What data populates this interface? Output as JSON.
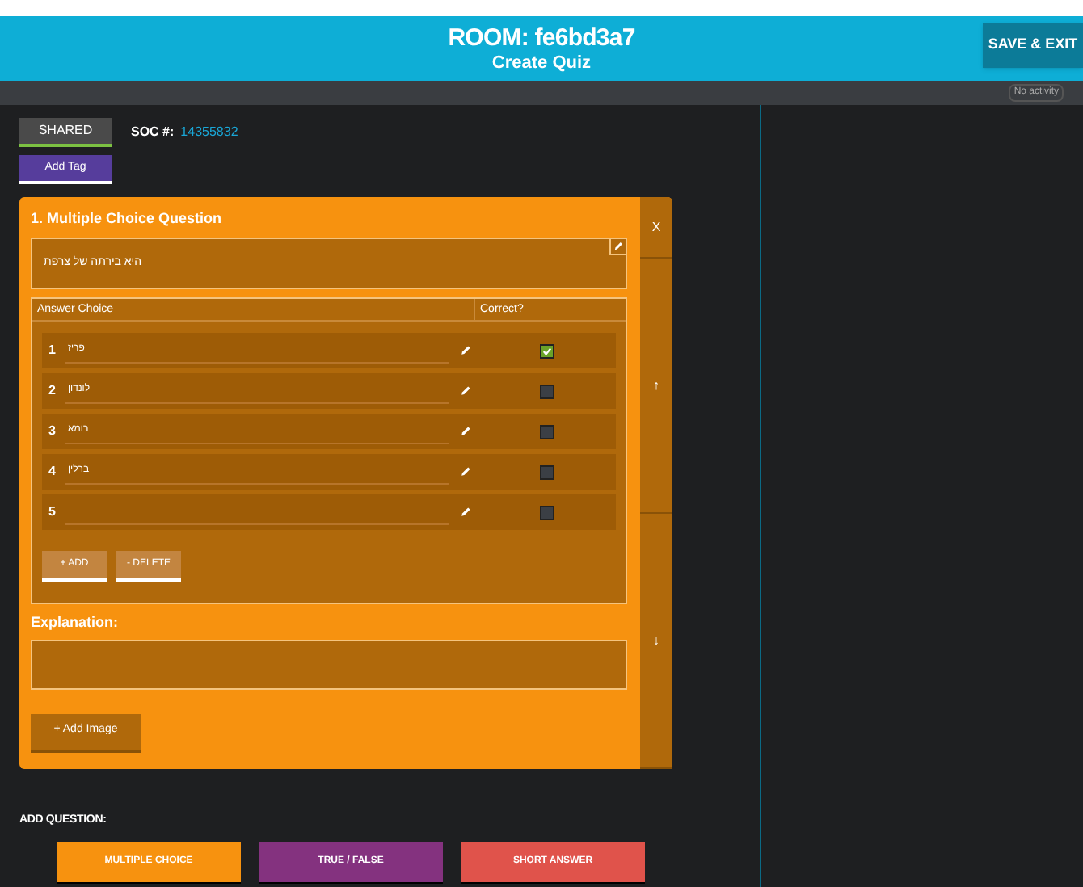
{
  "header": {
    "title": "ROOM: fe6bd3a7",
    "subtitle": "Create Quiz",
    "save_button": "SAVE & EXIT"
  },
  "status_bar": {
    "activity": "No activity"
  },
  "shared_button": "SHARED",
  "soc": {
    "label": "SOC #:",
    "value": "14355832"
  },
  "add_tag_button": "Add Tag",
  "question": {
    "title": "1. Multiple Choice Question",
    "text": "היא בירתה של צרפת",
    "side_buttons": [
      "X",
      "↑",
      "↓"
    ],
    "columns": [
      "Answer Choice",
      "Correct?"
    ],
    "answers": [
      {
        "number": "1",
        "text": "פריז",
        "checked": true
      },
      {
        "number": "2",
        "text": "לונדון",
        "checked": false
      },
      {
        "number": "3",
        "text": "רומא",
        "checked": false
      },
      {
        "number": "4",
        "text": "ברלין",
        "checked": false
      },
      {
        "number": "5",
        "checked": false
      }
    ],
    "add_button": "+ ADD",
    "delete_button": "- DELETE",
    "explanation_label": "Explanation:",
    "add_image_button": "+ Add Image"
  },
  "add_question": {
    "label": "ADD QUESTION:",
    "buttons": [
      {
        "label": "MULTIPLE CHOICE",
        "color": "#f7920f"
      },
      {
        "label": "TRUE / FALSE",
        "color": "#84327f"
      },
      {
        "label": "SHORT ANSWER",
        "color": "#e0534b"
      }
    ]
  }
}
